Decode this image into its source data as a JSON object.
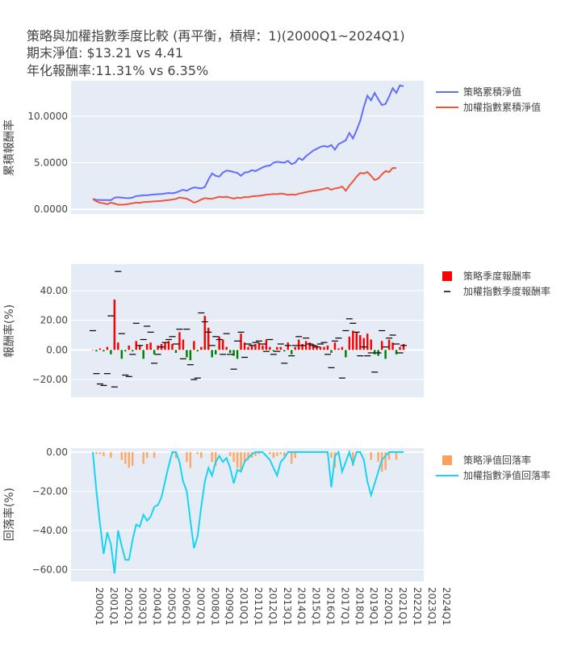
{
  "title": {
    "line1": "策略與加權指數季度比較 (再平衡，槓桿：1)(2000Q1~2024Q1)",
    "line2": "期末淨值: $13.21 vs 4.41",
    "line3": "年化報酬率:11.31% vs 6.35%"
  },
  "colors": {
    "background": "#ffffff",
    "plot_bg": "#e5ecf6",
    "grid": "#ffffff",
    "strategy_nav": "#636efa",
    "index_nav": "#ef553b",
    "bar_up": "#ff0000",
    "bar_down": "#008000",
    "index_ret_marker": "#000000",
    "strategy_dd": "#ffa15a",
    "index_dd": "#19d3f3",
    "text": "#444444"
  },
  "chart_data": [
    {
      "type": "line",
      "ylabel": "累積報酬率",
      "yticks": [
        "0.0000",
        "5.0000",
        "10.0000"
      ],
      "ylim": [
        -0.5,
        13.8
      ],
      "legend_position": "right",
      "series": [
        {
          "name": "策略累積淨值",
          "values": [
            1.12,
            1.02,
            1.0,
            0.99,
            1.0,
            0.98,
            1.25,
            1.3,
            1.25,
            1.22,
            1.2,
            1.25,
            1.42,
            1.45,
            1.52,
            1.5,
            1.55,
            1.6,
            1.62,
            1.65,
            1.7,
            1.75,
            1.72,
            1.8,
            1.95,
            2.1,
            2.0,
            2.2,
            2.35,
            2.3,
            2.25,
            2.4,
            3.2,
            3.85,
            3.6,
            3.5,
            3.95,
            4.15,
            4.1,
            4.0,
            3.9,
            3.6,
            3.95,
            4.0,
            4.2,
            4.1,
            4.3,
            4.5,
            4.65,
            4.7,
            5.0,
            5.1,
            5.05,
            5.0,
            5.2,
            4.85,
            5.0,
            5.5,
            5.3,
            5.7,
            6.0,
            6.3,
            6.5,
            6.7,
            6.8,
            6.7,
            6.9,
            6.4,
            7.0,
            7.2,
            7.4,
            8.2,
            7.6,
            8.5,
            9.5,
            11.0,
            12.2,
            11.7,
            12.5,
            11.8,
            11.2,
            11.3,
            12.1,
            13.0,
            12.5,
            13.3,
            13.21
          ]
        },
        {
          "name": "加權指數累積淨值",
          "values": [
            1.1,
            0.85,
            0.7,
            0.65,
            0.55,
            0.72,
            0.62,
            0.5,
            0.5,
            0.52,
            0.58,
            0.65,
            0.72,
            0.7,
            0.78,
            0.8,
            0.82,
            0.85,
            0.88,
            0.9,
            0.95,
            1.0,
            1.05,
            1.12,
            1.28,
            1.2,
            1.15,
            0.95,
            0.72,
            0.85,
            1.05,
            1.2,
            1.15,
            1.12,
            1.25,
            1.35,
            1.3,
            1.35,
            1.25,
            1.15,
            1.25,
            1.22,
            1.32,
            1.3,
            1.38,
            1.42,
            1.45,
            1.5,
            1.58,
            1.6,
            1.65,
            1.62,
            1.7,
            1.65,
            1.55,
            1.6,
            1.55,
            1.68,
            1.75,
            1.85,
            1.92,
            2.0,
            2.05,
            2.12,
            2.2,
            2.3,
            2.1,
            2.25,
            2.3,
            2.45,
            2.0,
            2.55,
            3.0,
            3.5,
            3.9,
            3.85,
            4.0,
            3.6,
            3.15,
            3.3,
            3.75,
            4.1,
            4.0,
            4.45,
            4.41
          ]
        }
      ]
    },
    {
      "type": "bar",
      "ylabel": "報酬率(%)",
      "yticks": [
        "−20.00",
        "0.00",
        "20.00",
        "40.00"
      ],
      "ylim": [
        -32,
        58
      ],
      "legend_position": "right",
      "series": [
        {
          "name": "策略季度報酬率",
          "values": [
            0,
            -1,
            1,
            -1,
            2,
            -3,
            34,
            5,
            -6,
            -1,
            3,
            -1,
            6,
            3,
            -6,
            4,
            5,
            -3,
            3,
            4,
            5,
            6,
            4,
            -2,
            12,
            7,
            -5,
            -7,
            6,
            -1,
            2,
            23,
            15,
            -5,
            -3,
            9,
            7,
            2,
            -2,
            -4,
            -6,
            11,
            5,
            2,
            3,
            4,
            5,
            3,
            7,
            2,
            -1,
            2,
            2,
            -1,
            5,
            -3,
            2,
            7,
            4,
            6,
            5,
            4,
            3,
            2,
            2,
            3,
            -2,
            5,
            1,
            2,
            -5,
            9,
            13,
            12,
            10,
            8,
            11,
            7,
            -3,
            -4,
            6,
            -6,
            7,
            5,
            -3,
            2,
            4
          ]
        },
        {
          "name": "加權指數季度報酬率",
          "values": [
            13,
            -16,
            -23,
            -24,
            -16,
            23,
            -25,
            53,
            11,
            -17,
            -18,
            -3,
            18,
            3,
            7,
            16,
            12,
            -9,
            -3,
            2,
            5,
            7,
            9,
            4,
            14,
            -6,
            14,
            -10,
            -20,
            -19,
            25,
            19,
            12,
            3,
            9,
            7,
            -3,
            11,
            -3,
            -13,
            6,
            12,
            -5,
            4,
            3,
            5,
            6,
            4,
            -1,
            7,
            -3,
            -1,
            4,
            -9,
            3,
            -4,
            3,
            9,
            3,
            8,
            4,
            3,
            2,
            4,
            5,
            -3,
            -12,
            6,
            8,
            -19,
            13,
            21,
            18,
            12,
            -4,
            2,
            -4,
            -2,
            -15,
            -2,
            13,
            2,
            8,
            10,
            4,
            -2,
            3
          ]
        }
      ]
    },
    {
      "type": "area",
      "ylabel": "回落率(%)",
      "yticks": [
        "−60.00",
        "−40.00",
        "−20.00",
        "0.00"
      ],
      "ylim": [
        -66,
        2
      ],
      "legend_position": "right",
      "categories": [
        "2000Q1",
        "2001Q1",
        "2002Q1",
        "2003Q1",
        "2004Q1",
        "2005Q1",
        "2006Q1",
        "2007Q1",
        "2008Q1",
        "2009Q1",
        "2010Q1",
        "2011Q1",
        "2012Q1",
        "2013Q1",
        "2014Q1",
        "2015Q1",
        "2016Q1",
        "2017Q1",
        "2018Q1",
        "2019Q1",
        "2020Q1",
        "2021Q1",
        "2022Q1",
        "2023Q1",
        "2024Q1"
      ],
      "series": [
        {
          "name": "策略淨值回落率",
          "values": [
            0,
            -1,
            -1,
            -2,
            0,
            -3,
            0,
            0,
            -4,
            -6,
            -8,
            -7,
            0,
            0,
            -6,
            -3,
            0,
            -3,
            0,
            0,
            0,
            0,
            -1,
            -3,
            0,
            0,
            -5,
            -8,
            0,
            -1,
            -3,
            0,
            0,
            -5,
            -7,
            0,
            0,
            0,
            -2,
            -5,
            -8,
            -10,
            -5,
            -4,
            -3,
            -2,
            -1,
            0,
            0,
            -1,
            -3,
            -2,
            -1,
            -2,
            0,
            -6,
            -3,
            0,
            0,
            0,
            0,
            0,
            0,
            0,
            0,
            -1,
            -3,
            -8,
            0,
            0,
            0,
            0,
            -7,
            0,
            0,
            0,
            0,
            -4,
            0,
            -5,
            -10,
            -9,
            -4,
            0,
            -4,
            0,
            0
          ]
        },
        {
          "name": "加權指數淨值回落率",
          "values": [
            0,
            -20,
            -37,
            -52,
            -41,
            -47,
            -62,
            -40,
            -48,
            -55,
            -55,
            -45,
            -37,
            -38,
            -32,
            -35,
            -33,
            -28,
            -27,
            -23,
            -15,
            -7,
            0,
            0,
            -5,
            -15,
            -20,
            -35,
            -49,
            -43,
            -28,
            -15,
            -8,
            -12,
            -5,
            -2,
            -5,
            -3,
            -8,
            -16,
            -9,
            -10,
            -5,
            -3,
            -1,
            0,
            0,
            0,
            -2,
            -4,
            -8,
            -12,
            -5,
            -3,
            0,
            0,
            0,
            0,
            0,
            0,
            0,
            0,
            0,
            0,
            0,
            0,
            -18,
            -2,
            0,
            -10,
            -5,
            0,
            -6,
            0,
            0,
            -4,
            -15,
            -22,
            -16,
            -10,
            -4,
            -2,
            0,
            0,
            0,
            0,
            0
          ]
        }
      ]
    }
  ]
}
